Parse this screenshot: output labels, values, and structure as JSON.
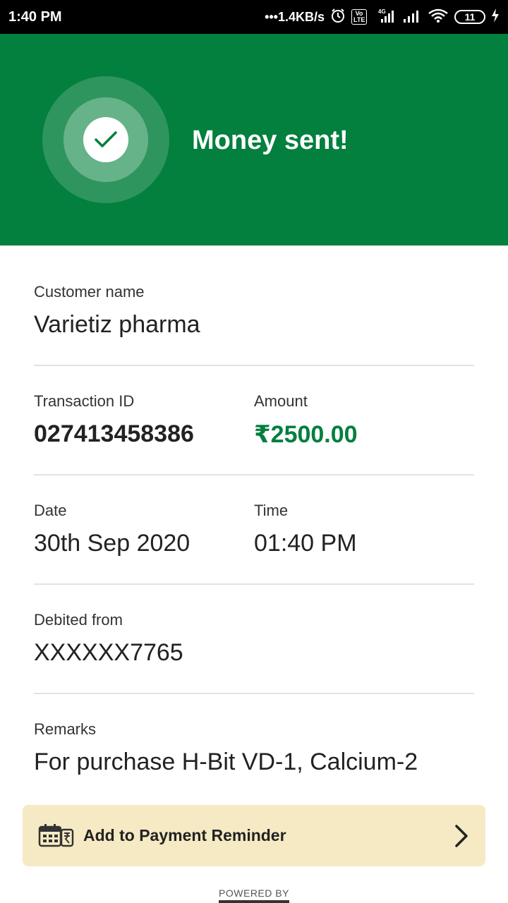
{
  "status_bar": {
    "time": "1:40 PM",
    "speed": "•••1.4KB/s",
    "network": "4G",
    "volte": "Vo LTE",
    "battery": "11"
  },
  "header": {
    "title": "Money sent!",
    "background": "#037f3e"
  },
  "details": {
    "customer_label": "Customer name",
    "customer_value": "Varietiz pharma",
    "transaction_label": "Transaction ID",
    "transaction_value": "027413458386",
    "amount_label": "Amount",
    "amount_value": "₹2500.00",
    "date_label": "Date",
    "date_value": "30th Sep 2020",
    "time_label": "Time",
    "time_value": "01:40 PM",
    "debited_label": "Debited from",
    "debited_value": "XXXXXX7765",
    "remarks_label": "Remarks",
    "remarks_value": "For purchase H-Bit VD-1, Calcium-2"
  },
  "reminder": {
    "label": "Add to Payment Reminder",
    "icon": "calendar-rupee-icon"
  },
  "footer": {
    "powered_by": "POWERED BY"
  },
  "colors": {
    "accent_green": "#037f3e",
    "reminder_bg": "#f6eac4"
  }
}
